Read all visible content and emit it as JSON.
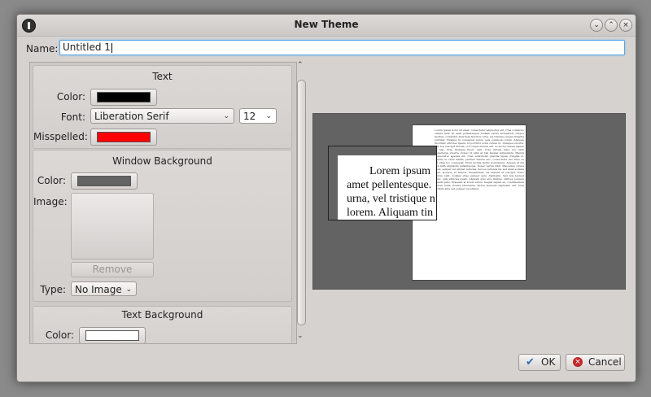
{
  "window": {
    "title": "New Theme"
  },
  "name_field": {
    "label": "Name:",
    "value": "Untitled 1"
  },
  "text_group": {
    "title": "Text",
    "color_label": "Color:",
    "color": "#000000",
    "font_label": "Font:",
    "font_value": "Liberation Serif",
    "size_value": "12",
    "misspelled_label": "Misspelled:",
    "misspelled_color": "#ff0000"
  },
  "window_background": {
    "title": "Window Background",
    "color_label": "Color:",
    "color": "#646464",
    "image_label": "Image:",
    "remove_label": "Remove",
    "type_label": "Type:",
    "type_value": "No Image"
  },
  "text_background": {
    "title": "Text Background",
    "color_label": "Color:",
    "color": "#ffffff"
  },
  "preview": {
    "background_color": "#636363",
    "large_text": [
      "Lorem ipsum",
      "amet pellentesque.",
      "urna, vel tristique n",
      "lorem. Aliquam tin"
    ],
    "page_text": "Lorem ipsum dolor sit amet, consectetur adipiscing elit. Cras commodo ornare nunc sit amet pellentesque. Nullam varius fermentum congue facilisis. Curabitur interdum faucibus urna, vel tristique massa fringilla pulvinar. Vivamus in consequat purus, quis commodo lorem. Aliquam tincidunt ultricies ipsum, id porttitor urna cursus ut. Quisque lobortis, nisl non suscipit dictum, orci turpis dictum elit, ac auctor massa sapien ut nisl. Cras tristique libero velit. Cras dictum justo nec nibh scelerisque viverra. Donec id nibh at nisl feugiat fermentum. Mauris consectetur egestas dui. Cras sollicitudin gravida ligula, fringilla id. Mauris ac risus mattis, pretium mauris nec, consectetur dui. Duis eu est vitae leo consequat. Proin lacinia mollis scelerisque. Aenean at dui non nibh dignissim pellentesque. Donec varius nibh. Maecenas cursus risus, semper vel aliquet vehicula. Sed eu vehicula mi, sed amet sodales eget, posuere id mauris. Suspendisse vel blandit ut suscipit. Nunc cursus velit, sodales vitae semper quis, dignissim. Sed non laoreet nunc, quis ultricies quam. Aliquam quis eros finibus, ultrices posuere blandit justo. Praesent at lorem varius, feugiat sapien eu, condimentum cursus nulla viverra bibendum. Morbi molestie dignissim elit. Cras facilisis ante sed semper vel aliquet."
  },
  "buttons": {
    "ok": "OK",
    "cancel": "Cancel"
  },
  "icons": {
    "app": "app-menu-icon",
    "minimize": "minimize-icon",
    "maximize": "maximize-icon",
    "close": "close-icon",
    "ok": "checkmark-icon",
    "cancel": "cancel-icon"
  }
}
